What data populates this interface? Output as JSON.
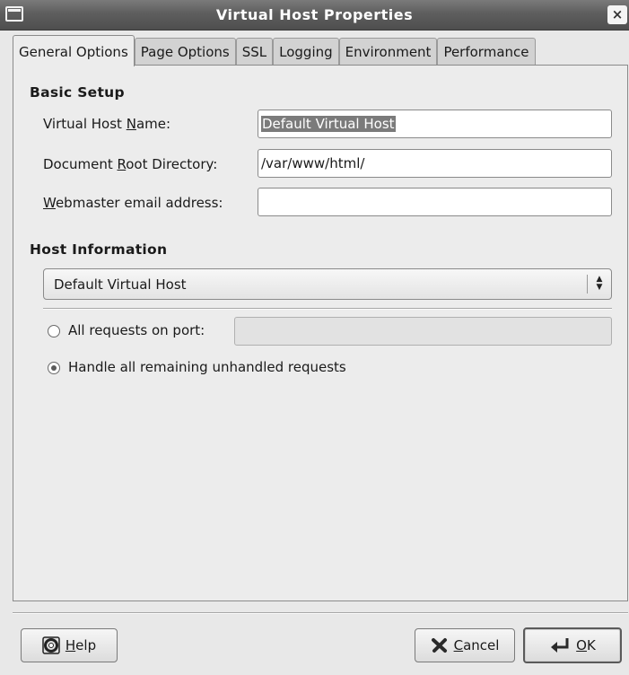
{
  "window": {
    "title": "Virtual Host Properties",
    "close_glyph": "×"
  },
  "tabs": [
    {
      "label": "General Options",
      "active": true
    },
    {
      "label": "Page Options",
      "active": false
    },
    {
      "label": "SSL",
      "active": false
    },
    {
      "label": "Logging",
      "active": false
    },
    {
      "label": "Environment",
      "active": false
    },
    {
      "label": "Performance",
      "active": false
    }
  ],
  "basic_setup": {
    "title": "Basic Setup",
    "name_label_pre": "Virtual Host ",
    "name_label_mnemonic": "N",
    "name_label_post": "ame:",
    "name_value": "Default Virtual Host",
    "docroot_label_pre": "Document ",
    "docroot_label_mnemonic": "R",
    "docroot_label_post": "oot Directory:",
    "docroot_value": "/var/www/html/",
    "email_label_pre": "",
    "email_label_mnemonic": "W",
    "email_label_post": "ebmaster email address:",
    "email_value": ""
  },
  "host_info": {
    "title": "Host Information",
    "combo_value": "Default Virtual Host",
    "radio_port_label": "All requests on port:",
    "radio_port_checked": false,
    "port_value": "",
    "radio_unhandled_label": "Handle all remaining unhandled requests",
    "radio_unhandled_checked": true
  },
  "buttons": {
    "help_mnemonic": "H",
    "help_rest": "elp",
    "cancel_mnemonic": "C",
    "cancel_rest": "ancel",
    "ok_mnemonic": "O",
    "ok_rest": "K"
  },
  "icons": {
    "help": "lifebuoy-icon",
    "cancel": "x-mark-icon",
    "ok": "return-arrow-icon"
  }
}
